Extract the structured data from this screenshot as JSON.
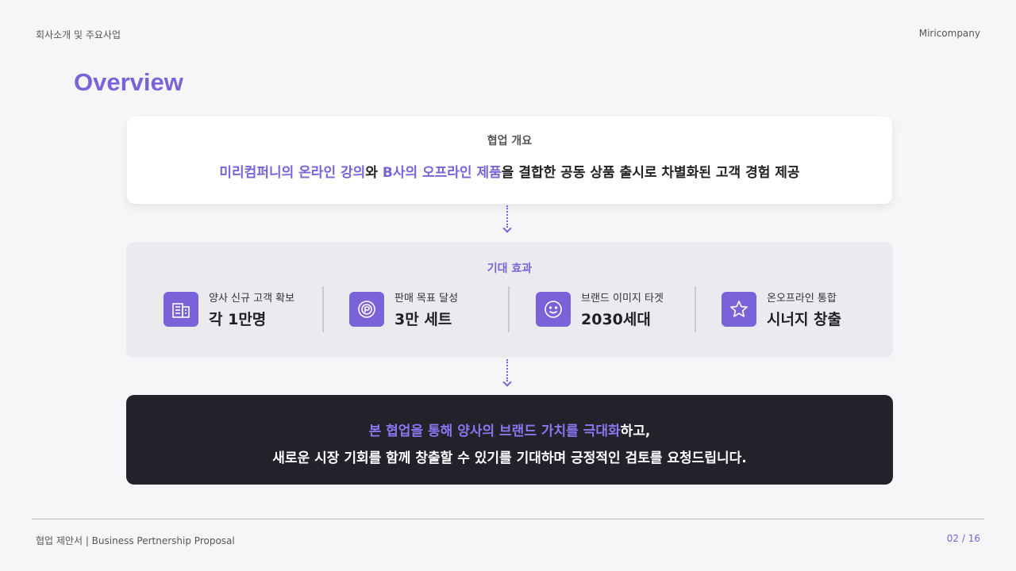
{
  "header": {
    "section": "회사소개 및 주요사업",
    "company": "Miricompany"
  },
  "title": "Overview",
  "summary": {
    "caption": "협업 개요",
    "parts": [
      {
        "text": "미리컴퍼니의 온라인 강의",
        "highlight": true
      },
      {
        "text": "와 ",
        "highlight": false
      },
      {
        "text": "B사의 오프라인 제품",
        "highlight": true
      },
      {
        "text": "을 결합한 공동 상품 출시로 차별화된 고객 경험 제공",
        "highlight": false
      }
    ]
  },
  "effects": {
    "caption": "기대 효과",
    "items": [
      {
        "label": "양사 신규 고객 확보",
        "value": "각 1만명",
        "icon": "building-icon"
      },
      {
        "label": "판매 목표 달성",
        "value": "3만 세트",
        "icon": "target-icon"
      },
      {
        "label": "브랜드 이미지 타겟",
        "value": "2030세대",
        "icon": "smile-icon"
      },
      {
        "label": "온오프라인 통합",
        "value": "시너지 창출",
        "icon": "star-icon"
      }
    ]
  },
  "closing": {
    "line1_highlight": "본 협업을 통해 양사의 브랜드 가치를 극대화",
    "line1_rest": "하고,",
    "line2": "새로운 시장 기회를 함께 창출할 수 있기를 기대하며 긍정적인 검토를 요청드립니다."
  },
  "footer": {
    "doc": "협업 제안서 | Business Pertnership Proposal",
    "page": "02 / 16"
  },
  "colors": {
    "accent": "#7a63d8",
    "dark_panel": "#22222b",
    "muted_panel": "#eaeaef"
  }
}
